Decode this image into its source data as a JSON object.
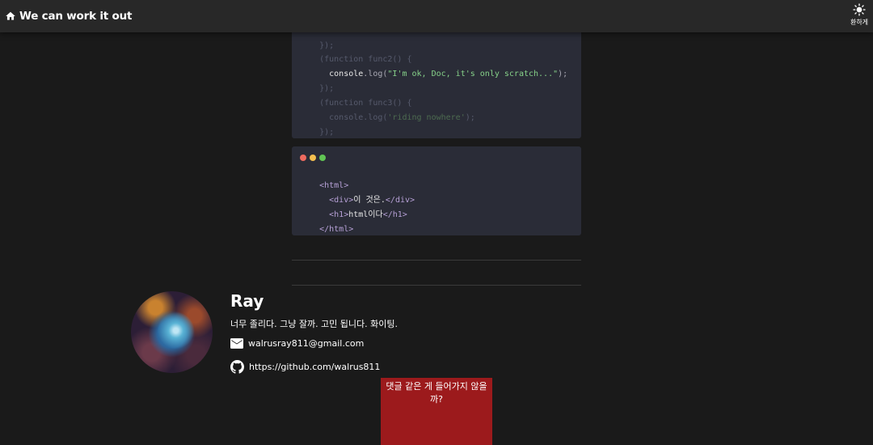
{
  "header": {
    "title": "We can work it out",
    "home_icon": "home-icon",
    "theme_toggle": {
      "icon": "sun-icon",
      "label": "환하게"
    }
  },
  "code_blocks": [
    {
      "lines": [
        [
          "})",
          ";"
        ],
        [
          "(function func2() {"
        ],
        [
          "  console",
          ".log(",
          "\"I'm ok, Doc, it's only scratch...\"",
          ");"
        ],
        [
          "})",
          ";"
        ],
        [
          "(function func3() {"
        ],
        [
          "  console",
          ".log(",
          "'riding nowhere'",
          ");"
        ],
        [
          "})",
          ";"
        ]
      ]
    },
    {
      "window_dots": [
        "#ed6a5e",
        "#f4bf4f",
        "#61c554"
      ],
      "lines": [
        [
          "<html>"
        ],
        [
          "  <div>",
          "이 것은.",
          "</div>"
        ],
        [
          "  <h1>",
          "html이다",
          "</h1>"
        ],
        [
          "</html>"
        ]
      ]
    }
  ],
  "bio": {
    "avatar_icon": "nebula-avatar",
    "name": "Ray",
    "description": "너무 졸리다. 그냥 잘까. 고민 됩니다. 화이팅.",
    "email": {
      "icon": "mail-icon",
      "text": "walrusray811@gmail.com"
    },
    "github": {
      "icon": "github-icon",
      "text": "https://github.com/walrus811"
    }
  },
  "comments": {
    "placeholder_text": "댓글 같은 게 들어가지 않을까?",
    "color": "#9c1a1c"
  }
}
